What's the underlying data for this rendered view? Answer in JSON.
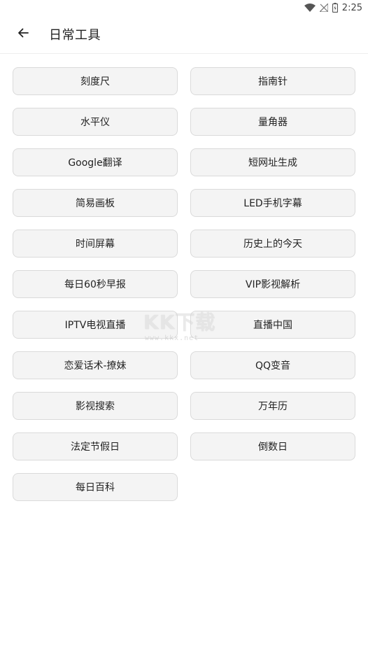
{
  "status_bar": {
    "time": "2:25",
    "icons": [
      "wifi-icon",
      "no-signal-icon",
      "battery-icon"
    ]
  },
  "toolbar": {
    "back_icon": "arrow-left-icon",
    "title": "日常工具"
  },
  "tools": [
    "刻度尺",
    "指南针",
    "水平仪",
    "量角器",
    "Google翻译",
    "短网址生成",
    "简易画板",
    "LED手机字幕",
    "时间屏幕",
    "历史上的今天",
    "每日60秒早报",
    "VIP影视解析",
    "IPTV电视直播",
    "直播中国",
    "恋爱话术-撩妹",
    "QQ变音",
    "影视搜索",
    "万年历",
    "法定节假日",
    "倒数日",
    "每日百科"
  ],
  "watermark": {
    "main": "KK下载",
    "sub": "www.kkx.net"
  },
  "colors": {
    "button_bg": "#f4f4f4",
    "button_border": "#dadada",
    "text": "#222222"
  }
}
